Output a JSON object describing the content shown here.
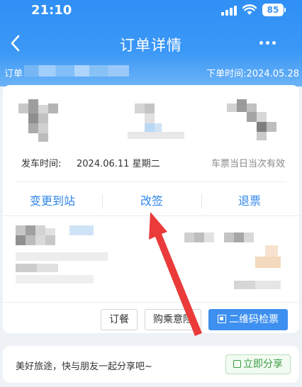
{
  "status_bar": {
    "time": "21:10",
    "battery": "85"
  },
  "nav": {
    "title": "订单详情"
  },
  "order": {
    "label": "订单",
    "time": "下单时间:2024.05.28"
  },
  "trip": {
    "depart_label": "发车时间:",
    "depart_date": "2024.06.11 星期二",
    "ticket_validity": "车票当日当次有效"
  },
  "actions": {
    "change_station": "变更到站",
    "reschedule": "改签",
    "refund": "退票"
  },
  "buttons": {
    "meal": "订餐",
    "insurance": "购乘意险",
    "qr_check": "二维码检票"
  },
  "share": {
    "text": "美好旅途，快与朋友一起分享吧~",
    "button": "立即分享"
  },
  "colors": {
    "header": "#2f8ff5",
    "accent": "#2f86ea",
    "primary_button": "#3d8ff0",
    "share_green": "#3a9d42",
    "annotation_arrow": "#ea3a3a"
  }
}
